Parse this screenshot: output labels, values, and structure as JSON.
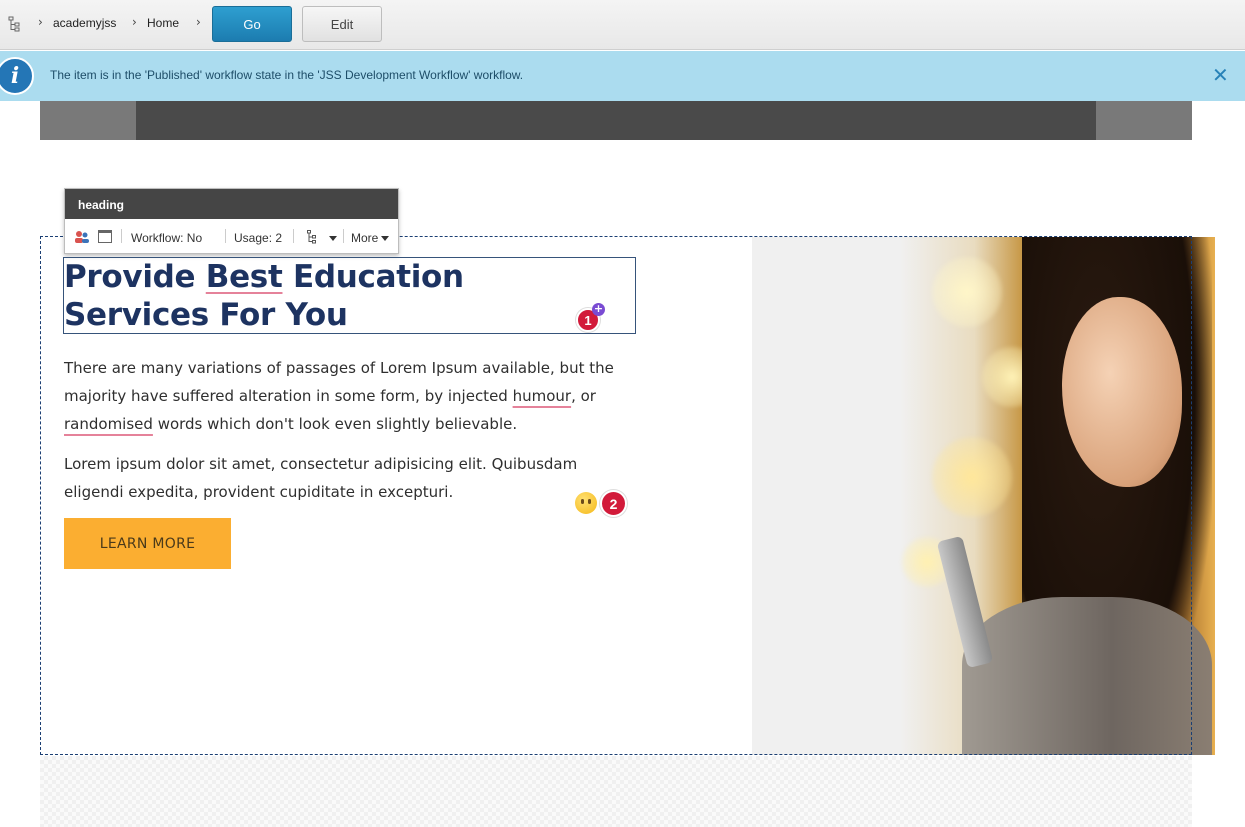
{
  "topbar": {
    "breadcrumbs": [
      "academyjss",
      "Home"
    ],
    "go_label": "Go",
    "edit_label": "Edit"
  },
  "notification": {
    "icon": "info-icon",
    "message": "The item is in the 'Published' workflow state in the 'JSS Development Workflow' workflow.",
    "close_icon": "close-icon"
  },
  "chrome": {
    "title": "heading",
    "workflow": "Workflow: No",
    "usage": "Usage: 2",
    "more": "More"
  },
  "content": {
    "heading_line1_a": "Provide ",
    "heading_line1_b": "Best",
    "heading_line1_c": " Education",
    "heading_line2": "Services For You",
    "para1_a": "There are many variations of passages of Lorem Ipsum available, but the majority have suffered alteration in some form, by injected ",
    "para1_b": "humour",
    "para1_c": ", or ",
    "para1_d": "randomised",
    "para1_e": " words which don't look even slightly believable.",
    "para2": "Lorem ipsum dolor sit amet, consectetur adipisicing elit. Quibusdam eligendi expedita, provident cupiditate in excepturi.",
    "button_label": "LEARN MORE",
    "badge1": "1",
    "badge2": "2"
  },
  "colors": {
    "accent_blue": "#1c7cb0",
    "notice_bg": "#abdcef",
    "heading": "#1d3361",
    "button": "#fbae31",
    "badge": "#d21a3a"
  }
}
